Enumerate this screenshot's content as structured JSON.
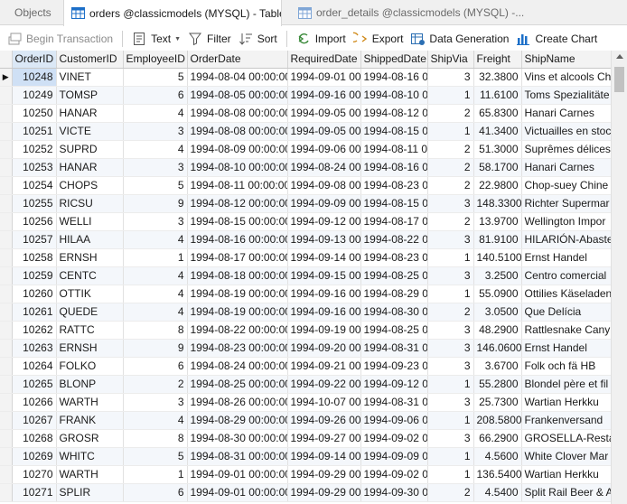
{
  "tabs": [
    {
      "label": "Objects"
    },
    {
      "label": "orders @classicmodels (MYSQL) - Table"
    },
    {
      "label": "order_details @classicmodels (MYSQL) -..."
    }
  ],
  "toolbar": {
    "begin_transaction": "Begin Transaction",
    "text": "Text",
    "filter": "Filter",
    "sort": "Sort",
    "import": "Import",
    "export": "Export",
    "data_generation": "Data Generation",
    "create_chart": "Create Chart"
  },
  "columns": [
    "OrderID",
    "CustomerID",
    "EmployeeID",
    "OrderDate",
    "RequiredDate",
    "ShippedDate",
    "ShipVia",
    "Freight",
    "ShipName"
  ],
  "rows": [
    [
      "10248",
      "VINET",
      "5",
      "1994-08-04 00:00:00",
      "1994-09-01 00:0",
      "1994-08-16 00",
      "3",
      "32.3800",
      "Vins et alcools Ch"
    ],
    [
      "10249",
      "TOMSP",
      "6",
      "1994-08-05 00:00:00",
      "1994-09-16 00:0",
      "1994-08-10 00",
      "1",
      "11.6100",
      "Toms Spezialitäte"
    ],
    [
      "10250",
      "HANAR",
      "4",
      "1994-08-08 00:00:00",
      "1994-09-05 00:0",
      "1994-08-12 00",
      "2",
      "65.8300",
      "Hanari Carnes"
    ],
    [
      "10251",
      "VICTE",
      "3",
      "1994-08-08 00:00:00",
      "1994-09-05 00:0",
      "1994-08-15 00",
      "1",
      "41.3400",
      "Victuailles en stoc"
    ],
    [
      "10252",
      "SUPRD",
      "4",
      "1994-08-09 00:00:00",
      "1994-09-06 00:0",
      "1994-08-11 00",
      "2",
      "51.3000",
      "Suprêmes délices"
    ],
    [
      "10253",
      "HANAR",
      "3",
      "1994-08-10 00:00:00",
      "1994-08-24 00:0",
      "1994-08-16 00",
      "2",
      "58.1700",
      "Hanari Carnes"
    ],
    [
      "10254",
      "CHOPS",
      "5",
      "1994-08-11 00:00:00",
      "1994-09-08 00:0",
      "1994-08-23 00",
      "2",
      "22.9800",
      "Chop-suey Chine"
    ],
    [
      "10255",
      "RICSU",
      "9",
      "1994-08-12 00:00:00",
      "1994-09-09 00:0",
      "1994-08-15 00",
      "3",
      "148.3300",
      "Richter Supermar"
    ],
    [
      "10256",
      "WELLI",
      "3",
      "1994-08-15 00:00:00",
      "1994-09-12 00:0",
      "1994-08-17 00",
      "2",
      "13.9700",
      "Wellington Impor"
    ],
    [
      "10257",
      "HILAA",
      "4",
      "1994-08-16 00:00:00",
      "1994-09-13 00:0",
      "1994-08-22 00",
      "3",
      "81.9100",
      "HILARIÓN-Abaste"
    ],
    [
      "10258",
      "ERNSH",
      "1",
      "1994-08-17 00:00:00",
      "1994-09-14 00:0",
      "1994-08-23 00",
      "1",
      "140.5100",
      "Ernst Handel"
    ],
    [
      "10259",
      "CENTC",
      "4",
      "1994-08-18 00:00:00",
      "1994-09-15 00:0",
      "1994-08-25 00",
      "3",
      "3.2500",
      "Centro comercial"
    ],
    [
      "10260",
      "OTTIK",
      "4",
      "1994-08-19 00:00:00",
      "1994-09-16 00:0",
      "1994-08-29 00",
      "1",
      "55.0900",
      "Ottilies Käseladen"
    ],
    [
      "10261",
      "QUEDE",
      "4",
      "1994-08-19 00:00:00",
      "1994-09-16 00:0",
      "1994-08-30 00",
      "2",
      "3.0500",
      "Que Delícia"
    ],
    [
      "10262",
      "RATTC",
      "8",
      "1994-08-22 00:00:00",
      "1994-09-19 00:0",
      "1994-08-25 00",
      "3",
      "48.2900",
      "Rattlesnake Cany"
    ],
    [
      "10263",
      "ERNSH",
      "9",
      "1994-08-23 00:00:00",
      "1994-09-20 00:0",
      "1994-08-31 00",
      "3",
      "146.0600",
      "Ernst Handel"
    ],
    [
      "10264",
      "FOLKO",
      "6",
      "1994-08-24 00:00:00",
      "1994-09-21 00:0",
      "1994-09-23 00",
      "3",
      "3.6700",
      "Folk och fä HB"
    ],
    [
      "10265",
      "BLONP",
      "2",
      "1994-08-25 00:00:00",
      "1994-09-22 00:0",
      "1994-09-12 00",
      "1",
      "55.2800",
      "Blondel père et fil"
    ],
    [
      "10266",
      "WARTH",
      "3",
      "1994-08-26 00:00:00",
      "1994-10-07 00:0",
      "1994-08-31 00",
      "3",
      "25.7300",
      "Wartian Herkku"
    ],
    [
      "10267",
      "FRANK",
      "4",
      "1994-08-29 00:00:00",
      "1994-09-26 00:0",
      "1994-09-06 00",
      "1",
      "208.5800",
      "Frankenversand"
    ],
    [
      "10268",
      "GROSR",
      "8",
      "1994-08-30 00:00:00",
      "1994-09-27 00:0",
      "1994-09-02 00",
      "3",
      "66.2900",
      "GROSELLA-Restau"
    ],
    [
      "10269",
      "WHITC",
      "5",
      "1994-08-31 00:00:00",
      "1994-09-14 00:0",
      "1994-09-09 00",
      "1",
      "4.5600",
      "White Clover Mar"
    ],
    [
      "10270",
      "WARTH",
      "1",
      "1994-09-01 00:00:00",
      "1994-09-29 00:0",
      "1994-09-02 00",
      "1",
      "136.5400",
      "Wartian Herkku"
    ],
    [
      "10271",
      "SPLIR",
      "6",
      "1994-09-01 00:00:00",
      "1994-09-29 00:0",
      "1994-09-30 00",
      "2",
      "4.5400",
      "Split Rail Beer & A"
    ]
  ],
  "colors": {
    "accent": "#1c6fc8",
    "selected_cell": "#cfe0f5",
    "row_alt": "#f4f7fb"
  }
}
